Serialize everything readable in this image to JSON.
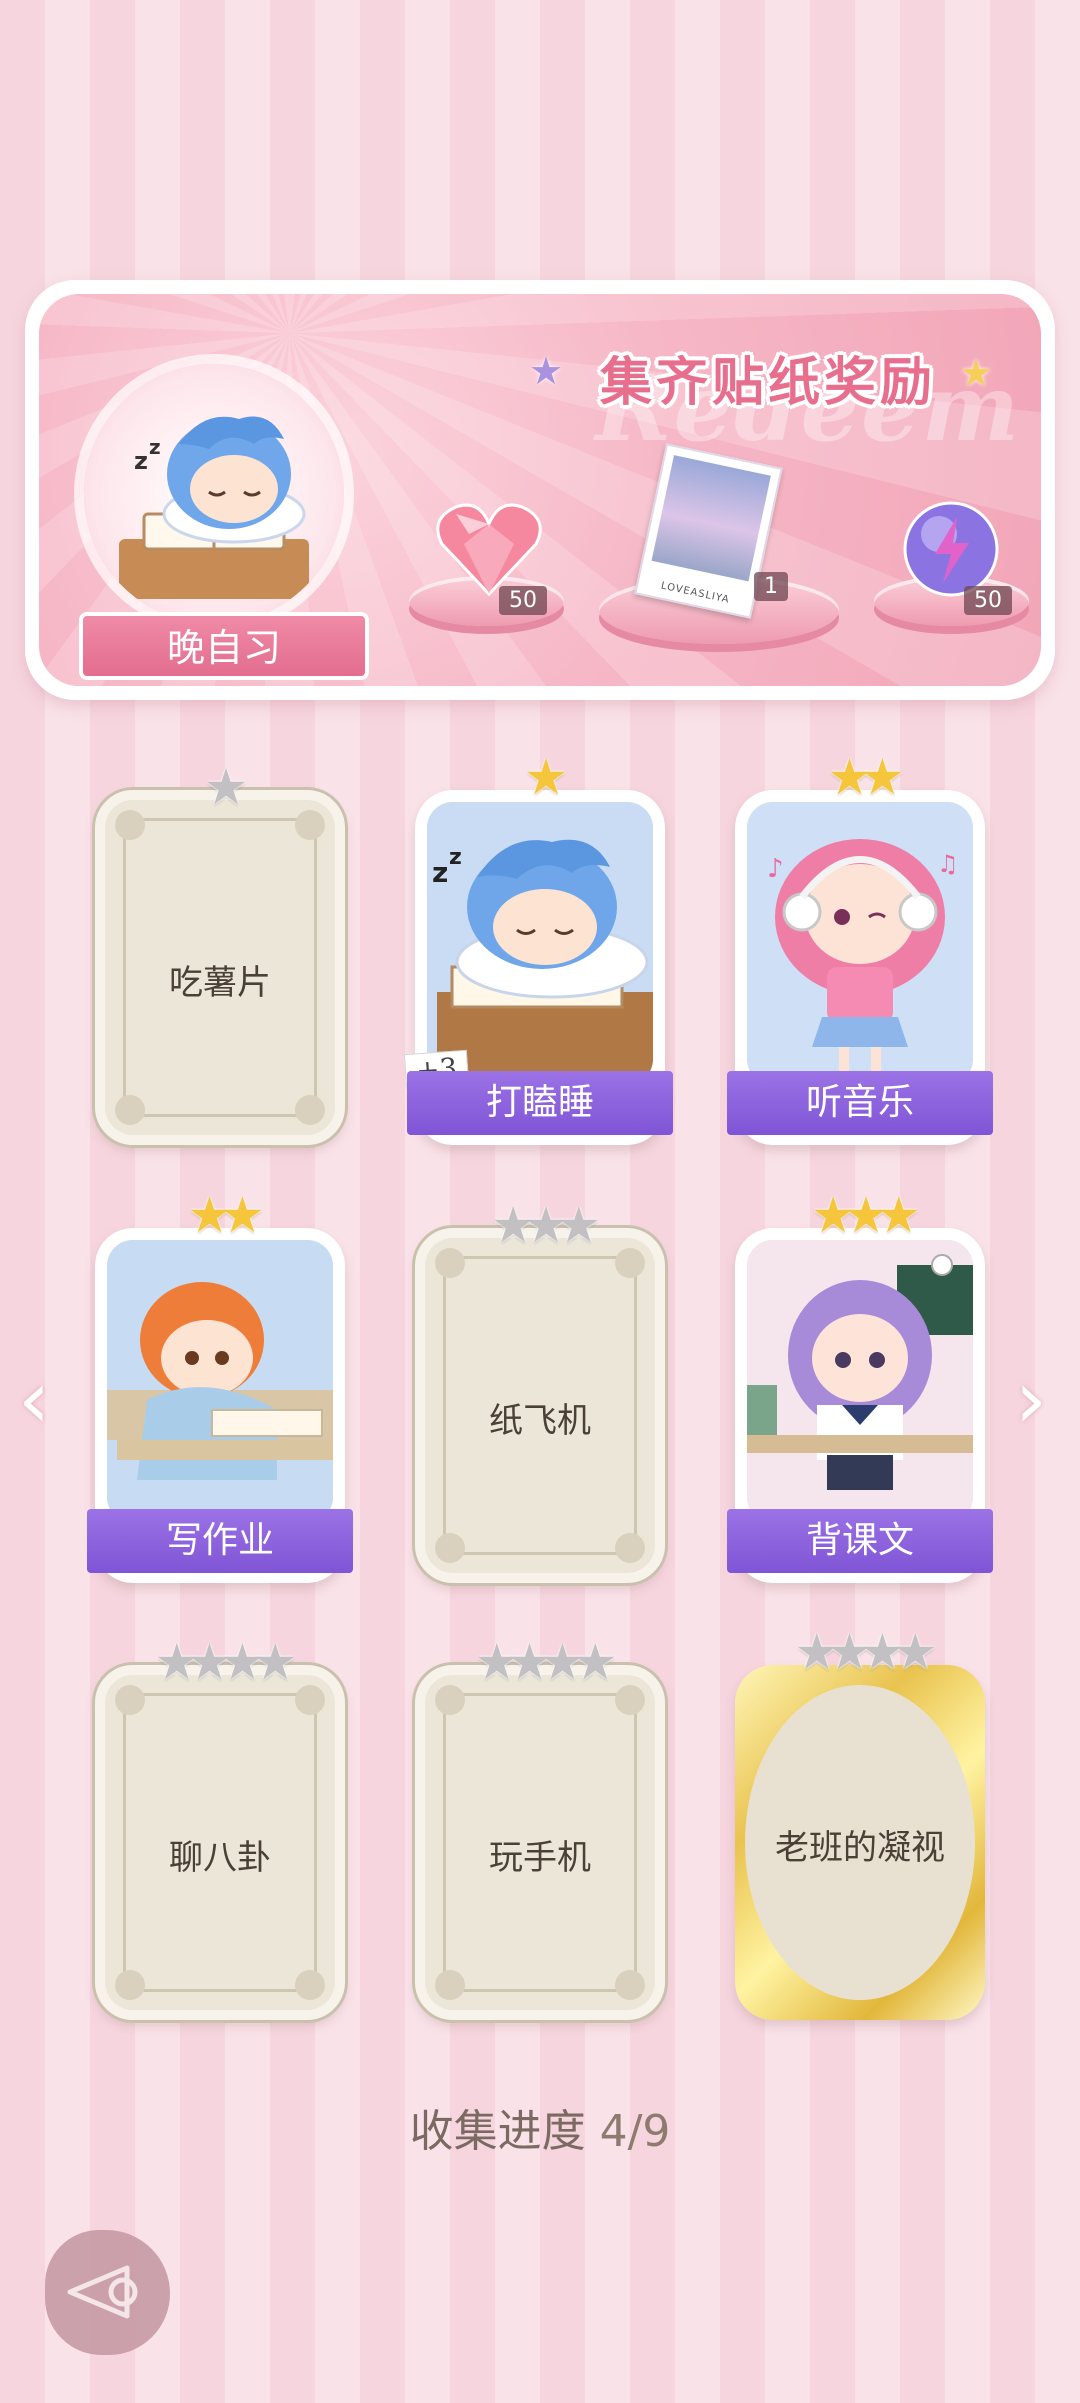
{
  "banner": {
    "title": "集齐贴纸奖励",
    "watermark": "Redeem",
    "level_name": "晚自习",
    "rewards": [
      {
        "name": "heart-gem-icon",
        "count": "50"
      },
      {
        "name": "photo-card-icon",
        "photo_caption": "LOVEASLIYA",
        "count": "1"
      },
      {
        "name": "lightning-orb-icon",
        "count": "50"
      }
    ]
  },
  "cards": [
    {
      "label": "吃薯片",
      "stars": "★",
      "star_color": "gray",
      "state": "locked"
    },
    {
      "label": "打瞌睡",
      "stars": "★",
      "star_color": "gold",
      "state": "unlocked",
      "bonus": "+3"
    },
    {
      "label": "听音乐",
      "stars": "★★",
      "star_color": "gold",
      "state": "unlocked"
    },
    {
      "label": "写作业",
      "stars": "★★",
      "star_color": "gold",
      "state": "unlocked"
    },
    {
      "label": "纸飞机",
      "stars": "★★★",
      "star_color": "gray",
      "state": "locked"
    },
    {
      "label": "背课文",
      "stars": "★★★",
      "star_color": "gold",
      "state": "unlocked"
    },
    {
      "label": "聊八卦",
      "stars": "★★★★",
      "star_color": "gray",
      "state": "locked"
    },
    {
      "label": "玩手机",
      "stars": "★★★★",
      "star_color": "gray",
      "state": "locked"
    },
    {
      "label": "老班的凝视",
      "stars": "★★★★",
      "star_color": "gray",
      "state": "locked-gold"
    }
  ],
  "nav": {
    "prev": "‹",
    "next": "›"
  },
  "progress": {
    "label": "收集进度",
    "value": "4/9"
  },
  "colors": {
    "accent_purple": "#8a60dc",
    "banner_pink": "#f4aabc",
    "title_pink": "#e86e8e"
  }
}
